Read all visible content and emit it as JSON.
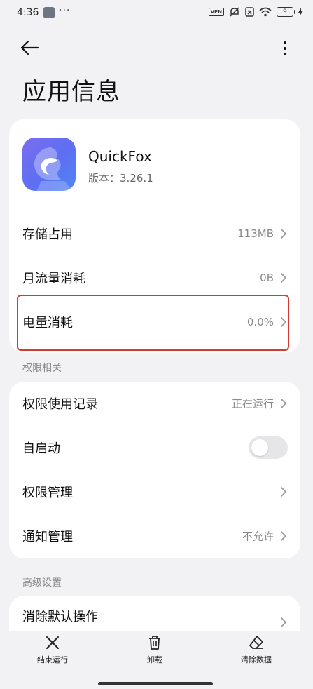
{
  "status_bar": {
    "time": "4:36",
    "dots": "···",
    "vpn": "VPN",
    "battery": "9"
  },
  "header": {
    "title": "应用信息"
  },
  "app": {
    "name": "QuickFox",
    "version": "版本：3.26.1"
  },
  "info_rows": [
    {
      "label": "存储占用",
      "value": "113MB"
    },
    {
      "label": "月流量消耗",
      "value": "0B"
    },
    {
      "label": "电量消耗",
      "value": "0.0%"
    }
  ],
  "permissions": {
    "section_title": "权限相关",
    "rows": [
      {
        "label": "权限使用记录",
        "value": "正在运行"
      },
      {
        "label": "自启动",
        "toggle_on": false
      },
      {
        "label": "权限管理",
        "value": ""
      },
      {
        "label": "通知管理",
        "value": "不允许"
      }
    ]
  },
  "advanced": {
    "section_title": "高级设置",
    "rows": [
      {
        "label": "消除默认操作"
      }
    ]
  },
  "bottom_actions": {
    "stop": "结束运行",
    "uninstall": "卸载",
    "clear": "清除数据"
  },
  "colors": {
    "highlight": "#d63a2e",
    "app_icon": "#6a72f0"
  }
}
